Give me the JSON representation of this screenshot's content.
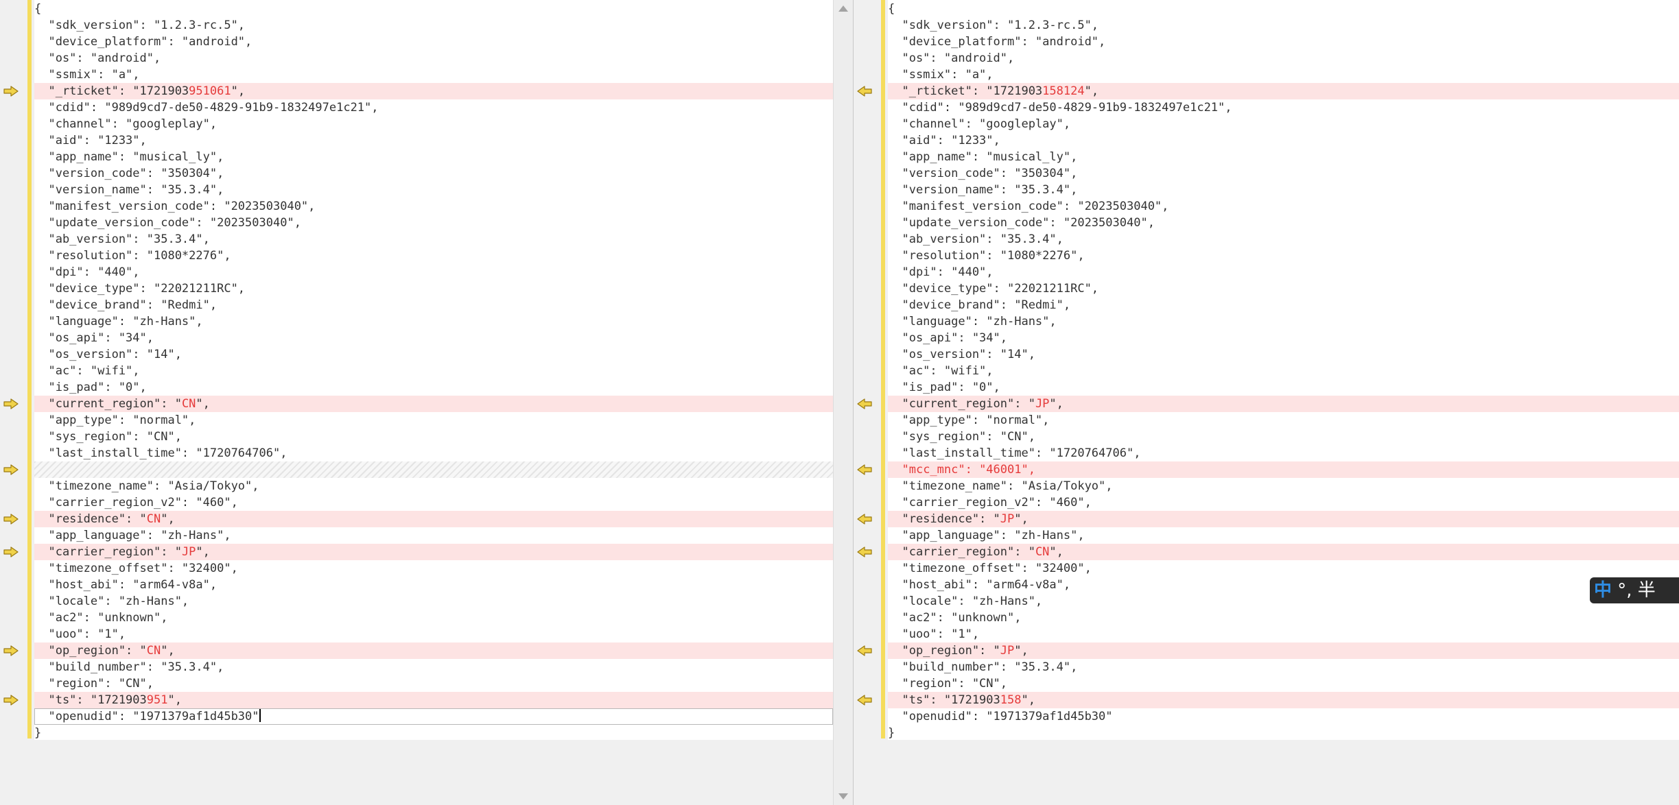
{
  "left_panel": {
    "lines": [
      {
        "segments": [
          "{"
        ],
        "state": "normal"
      },
      {
        "segments": [
          "  \"sdk_version\": \"1.2.3-rc.5\","
        ],
        "state": "normal"
      },
      {
        "segments": [
          "  \"device_platform\": \"android\","
        ],
        "state": "normal"
      },
      {
        "segments": [
          "  \"os\": \"android\","
        ],
        "state": "normal"
      },
      {
        "segments": [
          "  \"ssmix\": \"a\","
        ],
        "state": "normal"
      },
      {
        "segments": [
          "  \"_rticket\": \"1721903",
          "951061",
          "\","
        ],
        "state": "diff"
      },
      {
        "segments": [
          "  \"cdid\": \"989d9cd7-de50-4829-91b9-1832497e1c21\","
        ],
        "state": "normal"
      },
      {
        "segments": [
          "  \"channel\": \"googleplay\","
        ],
        "state": "normal"
      },
      {
        "segments": [
          "  \"aid\": \"1233\","
        ],
        "state": "normal"
      },
      {
        "segments": [
          "  \"app_name\": \"musical_ly\","
        ],
        "state": "normal"
      },
      {
        "segments": [
          "  \"version_code\": \"350304\","
        ],
        "state": "normal"
      },
      {
        "segments": [
          "  \"version_name\": \"35.3.4\","
        ],
        "state": "normal"
      },
      {
        "segments": [
          "  \"manifest_version_code\": \"2023503040\","
        ],
        "state": "normal"
      },
      {
        "segments": [
          "  \"update_version_code\": \"2023503040\","
        ],
        "state": "normal"
      },
      {
        "segments": [
          "  \"ab_version\": \"35.3.4\","
        ],
        "state": "normal"
      },
      {
        "segments": [
          "  \"resolution\": \"1080*2276\","
        ],
        "state": "normal"
      },
      {
        "segments": [
          "  \"dpi\": \"440\","
        ],
        "state": "normal"
      },
      {
        "segments": [
          "  \"device_type\": \"22021211RC\","
        ],
        "state": "normal"
      },
      {
        "segments": [
          "  \"device_brand\": \"Redmi\","
        ],
        "state": "normal"
      },
      {
        "segments": [
          "  \"language\": \"zh-Hans\","
        ],
        "state": "normal"
      },
      {
        "segments": [
          "  \"os_api\": \"34\","
        ],
        "state": "normal"
      },
      {
        "segments": [
          "  \"os_version\": \"14\","
        ],
        "state": "normal"
      },
      {
        "segments": [
          "  \"ac\": \"wifi\","
        ],
        "state": "normal"
      },
      {
        "segments": [
          "  \"is_pad\": \"0\","
        ],
        "state": "normal"
      },
      {
        "segments": [
          "  \"current_region\": \"",
          "CN",
          "\","
        ],
        "state": "diff"
      },
      {
        "segments": [
          "  \"app_type\": \"normal\","
        ],
        "state": "normal"
      },
      {
        "segments": [
          "  \"sys_region\": \"CN\","
        ],
        "state": "normal"
      },
      {
        "segments": [
          "  \"last_install_time\": \"1720764706\","
        ],
        "state": "normal"
      },
      {
        "segments": [
          ""
        ],
        "state": "filler"
      },
      {
        "segments": [
          "  \"timezone_name\": \"Asia/Tokyo\","
        ],
        "state": "normal"
      },
      {
        "segments": [
          "  \"carrier_region_v2\": \"460\","
        ],
        "state": "normal"
      },
      {
        "segments": [
          "  \"residence\": \"",
          "CN",
          "\","
        ],
        "state": "diff"
      },
      {
        "segments": [
          "  \"app_language\": \"zh-Hans\","
        ],
        "state": "normal"
      },
      {
        "segments": [
          "  \"carrier_region\": \"",
          "JP",
          "\","
        ],
        "state": "diff"
      },
      {
        "segments": [
          "  \"timezone_offset\": \"32400\","
        ],
        "state": "normal"
      },
      {
        "segments": [
          "  \"host_abi\": \"arm64-v8a\","
        ],
        "state": "normal"
      },
      {
        "segments": [
          "  \"locale\": \"zh-Hans\","
        ],
        "state": "normal"
      },
      {
        "segments": [
          "  \"ac2\": \"unknown\","
        ],
        "state": "normal"
      },
      {
        "segments": [
          "  \"uoo\": \"1\","
        ],
        "state": "normal"
      },
      {
        "segments": [
          "  \"op_region\": \"",
          "CN",
          "\","
        ],
        "state": "diff"
      },
      {
        "segments": [
          "  \"build_number\": \"35.3.4\","
        ],
        "state": "normal"
      },
      {
        "segments": [
          "  \"region\": \"CN\","
        ],
        "state": "normal"
      },
      {
        "segments": [
          "  \"ts\": \"1721903",
          "951",
          "\","
        ],
        "state": "diff"
      },
      {
        "segments": [
          "  \"openudid\": \"1971379af1d45b30\""
        ],
        "state": "cursor"
      },
      {
        "segments": [
          "}"
        ],
        "state": "normal"
      }
    ]
  },
  "right_panel": {
    "lines": [
      {
        "segments": [
          "{"
        ],
        "state": "normal"
      },
      {
        "segments": [
          "  \"sdk_version\": \"1.2.3-rc.5\","
        ],
        "state": "normal"
      },
      {
        "segments": [
          "  \"device_platform\": \"android\","
        ],
        "state": "normal"
      },
      {
        "segments": [
          "  \"os\": \"android\","
        ],
        "state": "normal"
      },
      {
        "segments": [
          "  \"ssmix\": \"a\","
        ],
        "state": "normal"
      },
      {
        "segments": [
          "  \"_rticket\": \"1721903",
          "158124",
          "\","
        ],
        "state": "diff"
      },
      {
        "segments": [
          "  \"cdid\": \"989d9cd7-de50-4829-91b9-1832497e1c21\","
        ],
        "state": "normal"
      },
      {
        "segments": [
          "  \"channel\": \"googleplay\","
        ],
        "state": "normal"
      },
      {
        "segments": [
          "  \"aid\": \"1233\","
        ],
        "state": "normal"
      },
      {
        "segments": [
          "  \"app_name\": \"musical_ly\","
        ],
        "state": "normal"
      },
      {
        "segments": [
          "  \"version_code\": \"350304\","
        ],
        "state": "normal"
      },
      {
        "segments": [
          "  \"version_name\": \"35.3.4\","
        ],
        "state": "normal"
      },
      {
        "segments": [
          "  \"manifest_version_code\": \"2023503040\","
        ],
        "state": "normal"
      },
      {
        "segments": [
          "  \"update_version_code\": \"2023503040\","
        ],
        "state": "normal"
      },
      {
        "segments": [
          "  \"ab_version\": \"35.3.4\","
        ],
        "state": "normal"
      },
      {
        "segments": [
          "  \"resolution\": \"1080*2276\","
        ],
        "state": "normal"
      },
      {
        "segments": [
          "  \"dpi\": \"440\","
        ],
        "state": "normal"
      },
      {
        "segments": [
          "  \"device_type\": \"22021211RC\","
        ],
        "state": "normal"
      },
      {
        "segments": [
          "  \"device_brand\": \"Redmi\","
        ],
        "state": "normal"
      },
      {
        "segments": [
          "  \"language\": \"zh-Hans\","
        ],
        "state": "normal"
      },
      {
        "segments": [
          "  \"os_api\": \"34\","
        ],
        "state": "normal"
      },
      {
        "segments": [
          "  \"os_version\": \"14\","
        ],
        "state": "normal"
      },
      {
        "segments": [
          "  \"ac\": \"wifi\","
        ],
        "state": "normal"
      },
      {
        "segments": [
          "  \"is_pad\": \"0\","
        ],
        "state": "normal"
      },
      {
        "segments": [
          "  \"current_region\": \"",
          "JP",
          "\","
        ],
        "state": "diff"
      },
      {
        "segments": [
          "  \"app_type\": \"normal\","
        ],
        "state": "normal"
      },
      {
        "segments": [
          "  \"sys_region\": \"CN\","
        ],
        "state": "normal"
      },
      {
        "segments": [
          "  \"last_install_time\": \"1720764706\","
        ],
        "state": "normal"
      },
      {
        "segments": [
          "  ",
          "\"mcc_mnc\": \"46001\","
        ],
        "state": "diff"
      },
      {
        "segments": [
          "  \"timezone_name\": \"Asia/Tokyo\","
        ],
        "state": "normal"
      },
      {
        "segments": [
          "  \"carrier_region_v2\": \"460\","
        ],
        "state": "normal"
      },
      {
        "segments": [
          "  \"residence\": \"",
          "JP",
          "\","
        ],
        "state": "diff"
      },
      {
        "segments": [
          "  \"app_language\": \"zh-Hans\","
        ],
        "state": "normal"
      },
      {
        "segments": [
          "  \"carrier_region\": \"",
          "CN",
          "\","
        ],
        "state": "diff"
      },
      {
        "segments": [
          "  \"timezone_offset\": \"32400\","
        ],
        "state": "normal"
      },
      {
        "segments": [
          "  \"host_abi\": \"arm64-v8a\","
        ],
        "state": "normal"
      },
      {
        "segments": [
          "  \"locale\": \"zh-Hans\","
        ],
        "state": "normal"
      },
      {
        "segments": [
          "  \"ac2\": \"unknown\","
        ],
        "state": "normal"
      },
      {
        "segments": [
          "  \"uoo\": \"1\","
        ],
        "state": "normal"
      },
      {
        "segments": [
          "  \"op_region\": \"",
          "JP",
          "\","
        ],
        "state": "diff"
      },
      {
        "segments": [
          "  \"build_number\": \"35.3.4\","
        ],
        "state": "normal"
      },
      {
        "segments": [
          "  \"region\": \"CN\","
        ],
        "state": "normal"
      },
      {
        "segments": [
          "  \"ts\": \"1721903",
          "158",
          "\","
        ],
        "state": "diff"
      },
      {
        "segments": [
          "  \"openudid\": \"1971379af1d45b30\""
        ],
        "state": "normal"
      },
      {
        "segments": [
          "}"
        ],
        "state": "normal"
      }
    ]
  },
  "ime_indicator": {
    "mode_label": "中",
    "rest_label": "°, 半"
  },
  "icons": {
    "left_gutter_marker": "arrow-right-icon",
    "right_gutter_marker": "arrow-left-icon",
    "scroll_up": "scroll-up-arrow-icon",
    "scroll_down": "scroll-down-arrow-icon"
  },
  "colors": {
    "diff_highlight": "#fde3e3",
    "changed_text": "#e53b3b",
    "change_bar": "#f5dc5c",
    "gutter_arrow_fill": "#f0d24a",
    "gutter_arrow_stroke": "#9a7a12"
  }
}
